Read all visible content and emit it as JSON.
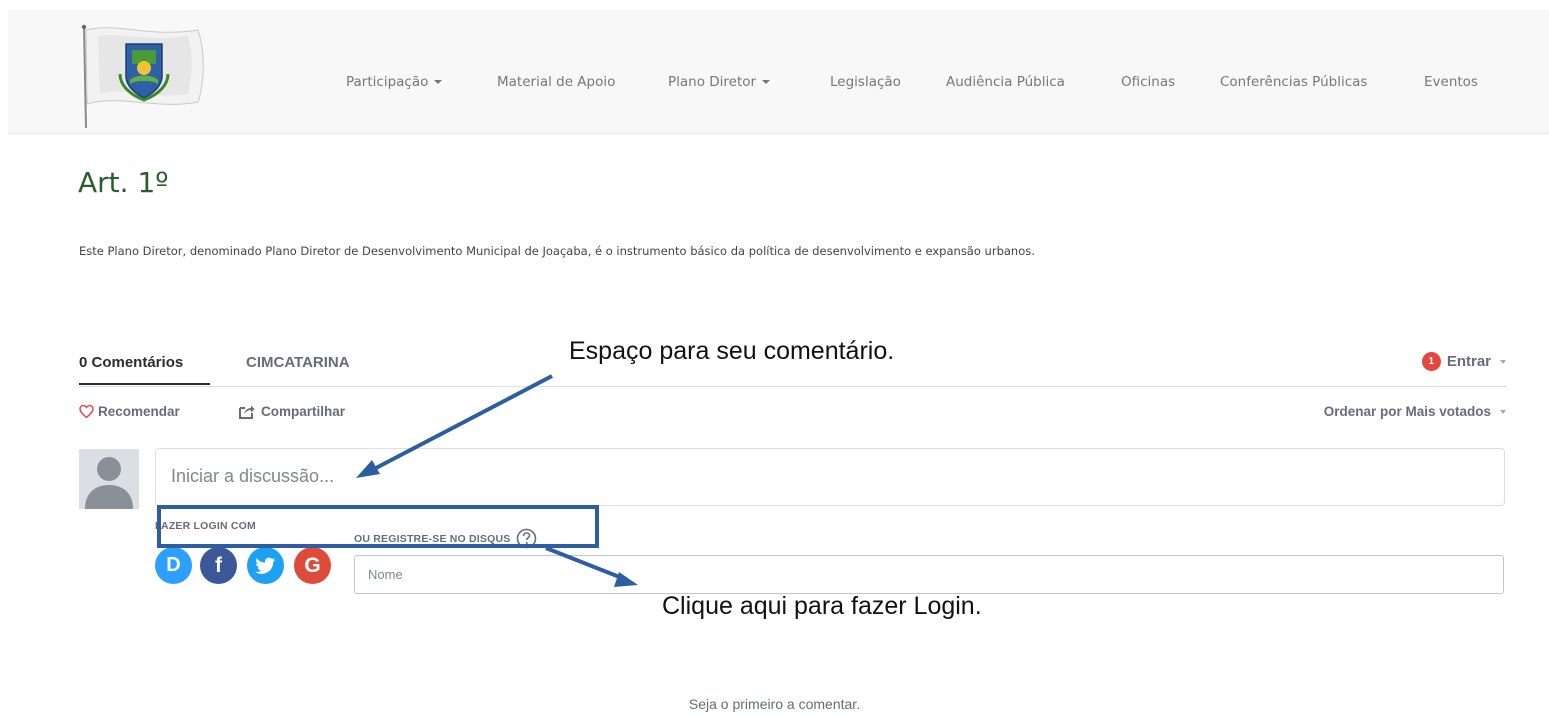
{
  "nav": {
    "items": [
      {
        "label": "Participação",
        "dropdown": true
      },
      {
        "label": "Material de Apoio",
        "dropdown": false
      },
      {
        "label": "Plano Diretor",
        "dropdown": true
      },
      {
        "label": "Legislação",
        "dropdown": false
      },
      {
        "label": "Audiência Pública",
        "dropdown": false
      },
      {
        "label": "Oficinas",
        "dropdown": false
      },
      {
        "label": "Conferências Públicas",
        "dropdown": false
      },
      {
        "label": "Eventos",
        "dropdown": false
      }
    ]
  },
  "article": {
    "title": "Art. 1º",
    "text": "Este Plano Diretor, denominado Plano Diretor de Desenvolvimento Municipal de Joaçaba, é o instrumento básico da política de desenvolvimento e expansão urbanos."
  },
  "comments": {
    "tab_count_label": "0 Comentários",
    "tab_community": "CIMCATARINA",
    "login_badge": "1",
    "login_label": "Entrar",
    "recommend_label": "Recomendar",
    "share_label": "Compartilhar",
    "sort_label": "Ordenar por Mais votados",
    "comment_placeholder": "Iniciar a discussão...",
    "login_with_label": "FAZER LOGIN COM",
    "register_label": "OU REGISTRE-SE NO DISQUS",
    "name_placeholder": "Nome",
    "empty_text": "Seja o primeiro a comentar.",
    "social_buttons": [
      {
        "name": "disqus",
        "letter": "D",
        "color": "#2e9fff"
      },
      {
        "name": "facebook",
        "letter": "f",
        "color": "#3b5998"
      },
      {
        "name": "twitter",
        "letter": "t",
        "color": "#1da1f2"
      },
      {
        "name": "google",
        "letter": "G",
        "color": "#dd4b39"
      }
    ]
  },
  "annotations": {
    "comment_space": "Espaço para seu comentário.",
    "login_here": "Clique aqui para fazer Login.",
    "color": "#2d5e9f"
  }
}
